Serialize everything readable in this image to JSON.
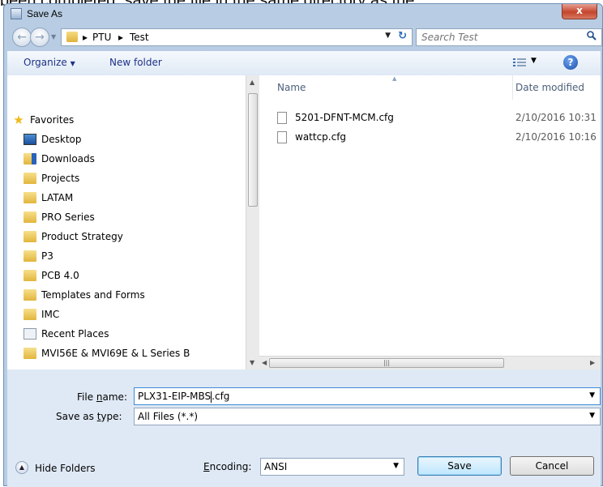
{
  "background_text": "been completed, save the file in the same directory as the",
  "window": {
    "title": "Save As",
    "close_label": "x"
  },
  "address": {
    "crumbs": [
      "PTU",
      "Test"
    ]
  },
  "search": {
    "placeholder": "Search Test"
  },
  "toolbar": {
    "organize_label": "Organize",
    "new_folder_label": "New folder",
    "help_label": "?"
  },
  "nav": {
    "favorites_label": "Favorites",
    "items": [
      {
        "label": "Desktop",
        "icon": "desktop-icon"
      },
      {
        "label": "Downloads",
        "icon": "downloads-folder-icon"
      },
      {
        "label": "Projects",
        "icon": "folder-icon"
      },
      {
        "label": "LATAM",
        "icon": "folder-icon"
      },
      {
        "label": "PRO Series",
        "icon": "folder-icon"
      },
      {
        "label": "Product Strategy",
        "icon": "folder-icon"
      },
      {
        "label": "P3",
        "icon": "folder-icon"
      },
      {
        "label": "PCB 4.0",
        "icon": "folder-icon"
      },
      {
        "label": "Templates and Forms",
        "icon": "folder-icon"
      },
      {
        "label": "IMC",
        "icon": "folder-icon"
      },
      {
        "label": "Recent Places",
        "icon": "recent-places-icon"
      },
      {
        "label": "MVI56E & MVI69E & L Series B",
        "icon": "folder-icon"
      }
    ]
  },
  "files": {
    "columns": {
      "name": "Name",
      "date": "Date modified"
    },
    "rows": [
      {
        "name": "5201-DFNT-MCM.cfg",
        "date": "2/10/2016 10:31 ..."
      },
      {
        "name": "wattcp.cfg",
        "date": "2/10/2016 10:16 ..."
      }
    ]
  },
  "form": {
    "file_name_label_pre": "File ",
    "file_name_label_u": "n",
    "file_name_label_post": "ame:",
    "file_name_before_caret": "PLX31-EIP-MBS",
    "file_name_after_caret": ".cfg",
    "save_type_label_pre": "Save as ",
    "save_type_label_u": "t",
    "save_type_label_post": "ype:",
    "save_type_value": "All Files  (*.*)",
    "encoding_label_u": "E",
    "encoding_label_post": "ncoding:",
    "encoding_value": "ANSI",
    "save_label": "Save",
    "cancel_label": "Cancel",
    "hide_folders_label": "Hide Folders"
  },
  "colors": {
    "titlebar": "#b8cde3",
    "close": "#c4452c",
    "link": "#1e3287",
    "form_bg": "#dfe9f5"
  }
}
